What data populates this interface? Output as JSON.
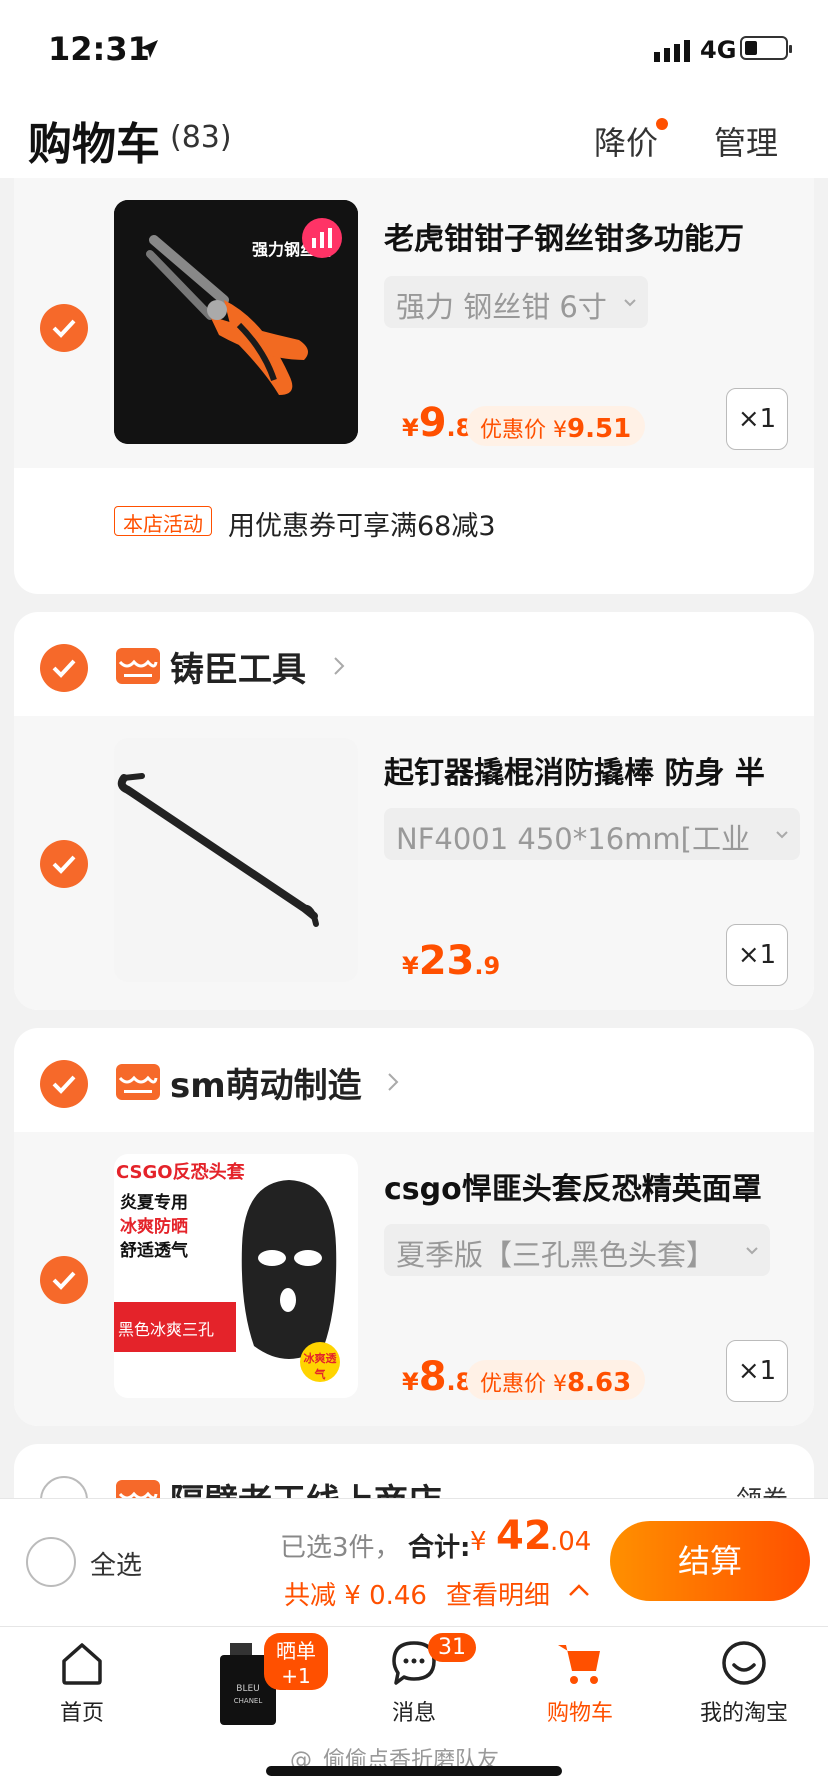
{
  "status_bar": {
    "time": "12:31",
    "network": "4G"
  },
  "header": {
    "title": "购物车",
    "count": "(83)",
    "price_drop": "降价",
    "manage": "管理"
  },
  "shops": [
    {
      "name": "",
      "checked": true,
      "items": [
        {
          "title": "老虎钳钳子钢丝钳多功能万",
          "sku": "强力 钢丝钳 6寸",
          "price_currency": "¥",
          "price_int": "9",
          "price_dec": ".8",
          "promo_label": "优惠价",
          "promo_currency": "¥",
          "promo_value": "9.51",
          "qty": "×1",
          "image_text": "强力钢丝钳"
        }
      ],
      "activity_tag": "本店活动",
      "activity_text": "用优惠券可享满68减3"
    },
    {
      "name": "铸臣工具",
      "checked": true,
      "items": [
        {
          "title": "起钉器撬棍消防撬棒 防身 半",
          "sku": "NF4001 450*16mm[工业",
          "price_currency": "¥",
          "price_int": "23",
          "price_dec": ".9",
          "qty": "×1"
        }
      ]
    },
    {
      "name": "sm萌动制造",
      "checked": true,
      "items": [
        {
          "title": "csgo悍匪头套反恐精英面罩",
          "sku": "夏季版【三孔黑色头套】",
          "price_currency": "¥",
          "price_int": "8",
          "price_dec": ".8",
          "promo_label": "优惠价",
          "promo_currency": "¥",
          "promo_value": "8.63",
          "qty": "×1",
          "image_lines": [
            "CSGO反恐头套",
            "炎夏专用",
            "冰爽防晒",
            "舒适透气",
            "黑色冰爽三孔",
            "冰爽透气"
          ]
        }
      ]
    },
    {
      "name": "隔壁老王线上商店",
      "checked": false,
      "coupon": "领券"
    }
  ],
  "bottom_bar": {
    "select_all": "全选",
    "selected": "已选3件，",
    "total_label": "合计:",
    "total_currency": "¥",
    "total_int": "42",
    "total_dec": ".04",
    "savings": "共减 ¥ 0.46",
    "detail": "查看明细",
    "checkout": "结算"
  },
  "tab_bar": {
    "tabs": [
      {
        "label": "首页",
        "icon": "home-icon"
      },
      {
        "label": "",
        "icon": "product-promo-image",
        "badge": "晒单+1"
      },
      {
        "label": "消息",
        "icon": "message-icon",
        "badge": "31"
      },
      {
        "label": "购物车",
        "icon": "cart-icon",
        "active": true
      },
      {
        "label": "我的淘宝",
        "icon": "profile-icon"
      }
    ]
  },
  "watermark": "@_偷偷点香折磨队友",
  "colors": {
    "accent": "#ff5000",
    "check": "#f6692a",
    "promo_bg": "#fff1e6"
  }
}
